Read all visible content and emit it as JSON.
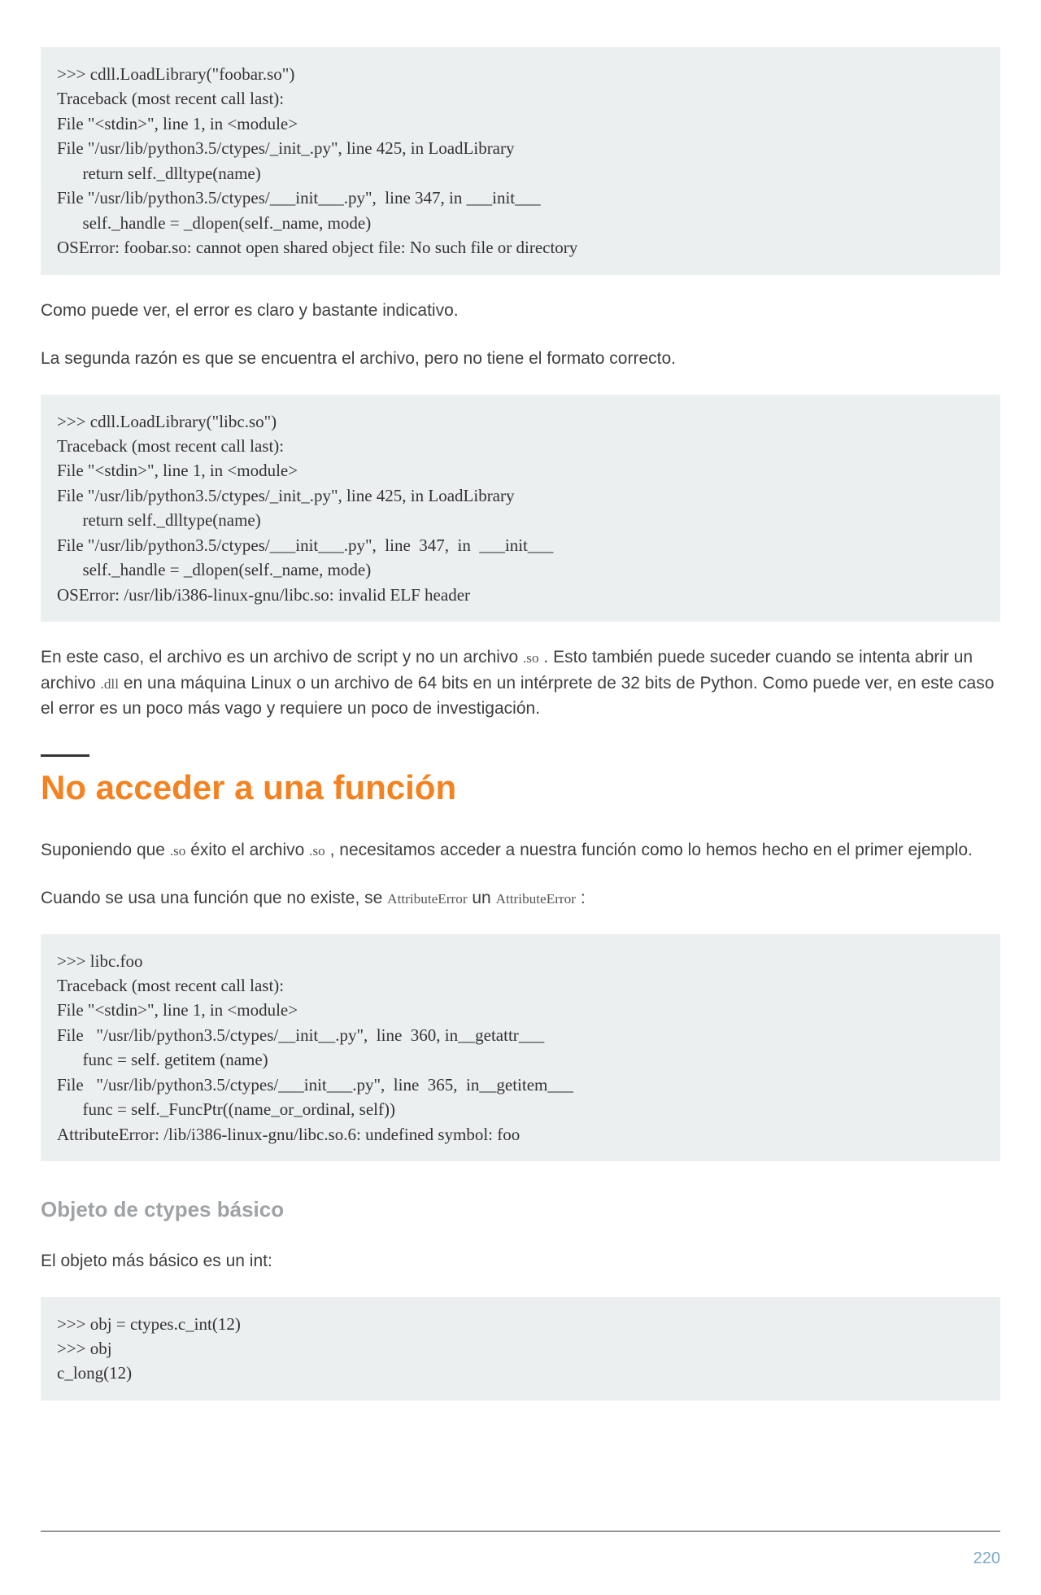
{
  "code1": ">>> cdll.LoadLibrary(\"foobar.so\")\nTraceback (most recent call last):\nFile \"<stdin>\", line 1, in <module>\nFile \"/usr/lib/python3.5/ctypes/_init_.py\", line 425, in LoadLibrary\n      return self._dlltype(name)\nFile \"/usr/lib/python3.5/ctypes/___init___.py\",  line 347, in ___init___\n      self._handle = _dlopen(self._name, mode)\nOSError: foobar.so: cannot open shared object file: No such file or directory",
  "para1": "Como puede ver, el error es claro y bastante indicativo.",
  "para2": "La segunda razón es que se encuentra el archivo, pero no tiene el formato correcto.",
  "code2": ">>> cdll.LoadLibrary(\"libc.so\")\nTraceback (most recent call last):\nFile \"<stdin>\", line 1, in <module>\nFile \"/usr/lib/python3.5/ctypes/_init_.py\", line 425, in LoadLibrary\n      return self._dlltype(name)\nFile \"/usr/lib/python3.5/ctypes/___init___.py\",  line  347,  in  ___init___\n      self._handle = _dlopen(self._name, mode)\nOSError: /usr/lib/i386-linux-gnu/libc.so: invalid ELF header",
  "para3_a": "En este caso, el archivo es un archivo de script y no un archivo ",
  "para3_so": ".so",
  "para3_b": " . Esto también puede suceder cuando se intenta abrir un archivo ",
  "para3_dll": ".dll",
  "para3_c": " en una máquina Linux o un archivo de 64 bits en un intérprete de 32 bits de Python. Como puede ver, en este caso el error es un poco más vago y requiere un poco de investigación.",
  "h1": "No acceder a una función",
  "para4_a": "Suponiendo que ",
  "para4_so1": ".so",
  "para4_b": " éxito el archivo ",
  "para4_so2": ".so",
  "para4_c": " , necesitamos acceder a nuestra función como lo hemos hecho en el primer ejemplo.",
  "para5_a": "Cuando se usa una función que no existe, se ",
  "para5_ae1": "AttributeError",
  "para5_b": " un ",
  "para5_ae2": "AttributeError",
  "para5_c": " :",
  "code3": ">>> libc.foo\nTraceback (most recent call last):\nFile \"<stdin>\", line 1, in <module>\nFile   \"/usr/lib/python3.5/ctypes/__init__.py\",  line  360, in__getattr___\n      func = self. getitem (name)\nFile   \"/usr/lib/python3.5/ctypes/___init___.py\",  line  365,  in__getitem___\n      func = self._FuncPtr((name_or_ordinal, self))\nAttributeError: /lib/i386-linux-gnu/libc.so.6: undefined symbol: foo",
  "h2": "Objeto de ctypes básico",
  "para6": "El objeto más básico es un int:",
  "code4": ">>> obj = ctypes.c_int(12)\n>>> obj\nc_long(12)",
  "pagenum": "220"
}
